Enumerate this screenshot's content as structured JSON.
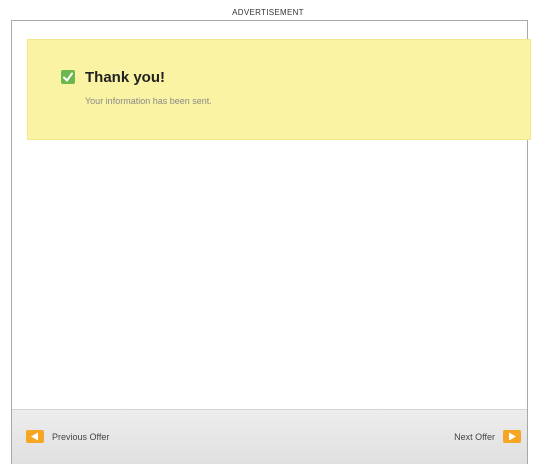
{
  "ad_label": "ADVERTISEMENT",
  "confirmation": {
    "title": "Thank you!",
    "message": "Your information has been sent.",
    "icon": "checkbox-checked-icon",
    "banner_color": "#fbf3a4",
    "check_color": "#6cb84f"
  },
  "navigation": {
    "previous_label": "Previous Offer",
    "next_label": "Next Offer",
    "arrow_color": "#f6a623"
  }
}
